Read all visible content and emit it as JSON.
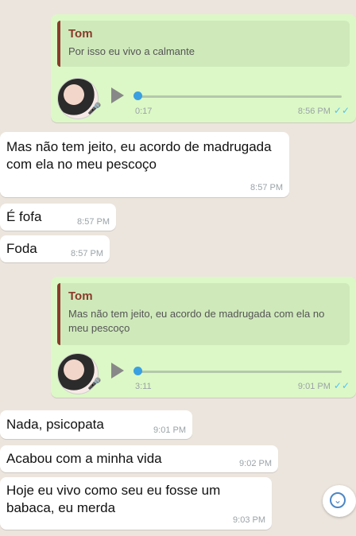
{
  "messages": [
    {
      "type": "outgoing_voice_reply",
      "quote_author": "Tom",
      "quote_text": "Por isso eu vivo a calmante",
      "duration": "0:17",
      "time": "8:56 PM",
      "ticks": "✓✓"
    },
    {
      "type": "incoming",
      "text": "Mas não tem jeito, eu acordo de madrugada com ela no meu pescoço",
      "time": "8:57 PM"
    },
    {
      "type": "incoming",
      "text": "É fofa",
      "time": "8:57 PM"
    },
    {
      "type": "incoming",
      "text": "Foda",
      "time": "8:57 PM"
    },
    {
      "type": "outgoing_voice_reply",
      "quote_author": "Tom",
      "quote_text": "Mas não tem jeito, eu acordo de madrugada com ela no meu pescoço",
      "duration": "3:11",
      "time": "9:01 PM",
      "ticks": "✓✓"
    },
    {
      "type": "incoming",
      "text": "Nada, psicopata",
      "time": "9:01 PM"
    },
    {
      "type": "incoming",
      "text": "Acabou com a minha vida",
      "time": "9:02 PM"
    },
    {
      "type": "incoming",
      "text": "Hoje eu vivo como seu eu fosse um babaca, eu merda",
      "time": "9:03 PM"
    }
  ],
  "icons": {
    "scroll_down": "chevron-down-circle-icon",
    "mic": "microphone-icon",
    "play": "play-icon"
  },
  "colors": {
    "background": "#ECE5DD",
    "outgoing": "#DCF8C6",
    "incoming": "#FFFFFF",
    "quote_bar": "#8a3b2a",
    "ticks": "#4fc3f7"
  }
}
